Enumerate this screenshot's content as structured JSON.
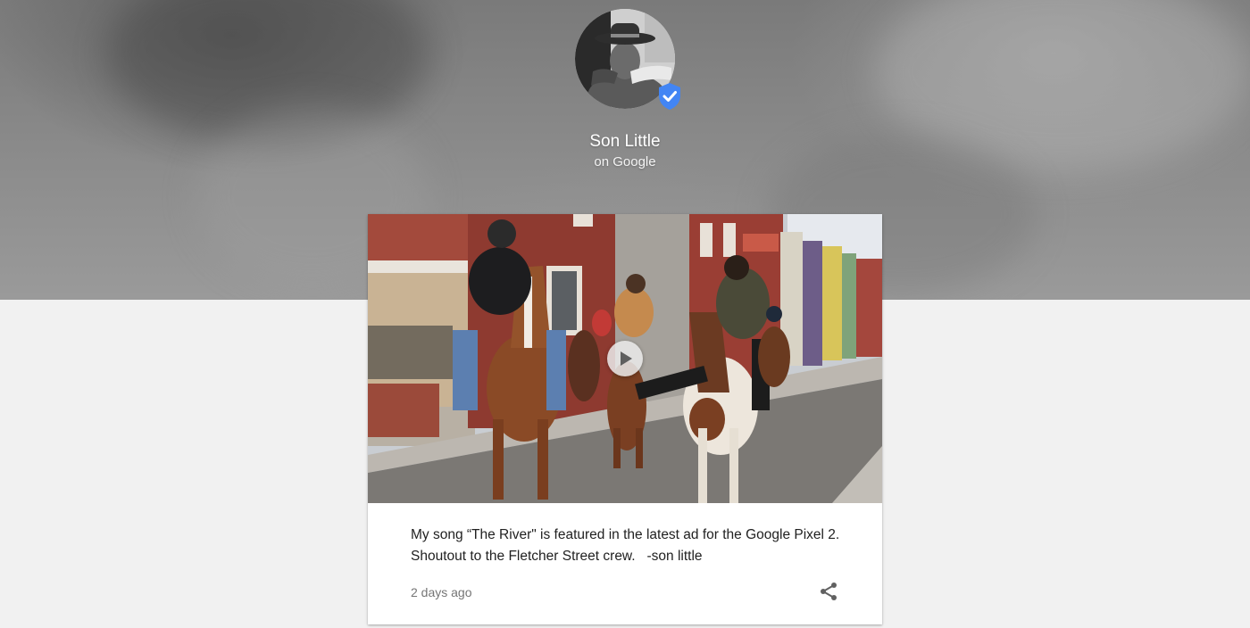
{
  "profile": {
    "name": "Son Little",
    "subtitle": "on Google",
    "avatar_icon": "avatar",
    "verified_icon": "verified-shield-icon",
    "verified_color": "#4285f4"
  },
  "post": {
    "media_type": "video",
    "play_icon": "play-icon",
    "text": "My song “The River\" is featured in the latest ad for the Google Pixel 2. Shoutout to the Fletcher Street crew.   -son little",
    "timestamp": "2 days ago",
    "share_icon": "share-icon"
  },
  "colors": {
    "hero_gray": "#8c8c8c",
    "page_background": "#f1f1f1",
    "card_background": "#ffffff",
    "text_primary": "#212121",
    "text_secondary": "#757575"
  }
}
